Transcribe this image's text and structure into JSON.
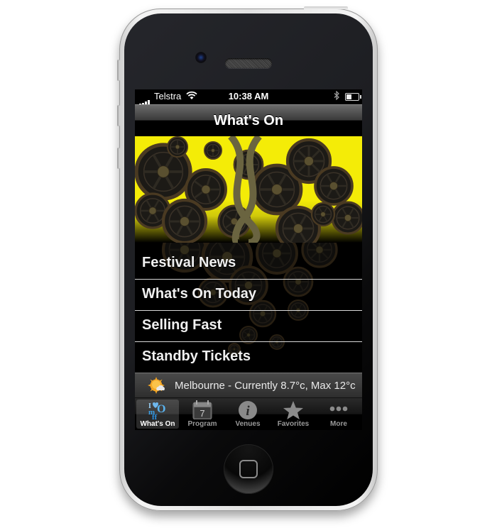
{
  "status_bar": {
    "carrier": "Telstra",
    "time": "10:38 AM",
    "wifi_icon": "wifi-icon",
    "bluetooth_icon": "bluetooth-icon",
    "battery_level": 0.45
  },
  "nav": {
    "title": "What's On"
  },
  "hero": {
    "image": "gears-heart-dna-artwork"
  },
  "menu": {
    "items": [
      {
        "label": "Festival News"
      },
      {
        "label": "What's On Today"
      },
      {
        "label": "Selling Fast"
      },
      {
        "label": "Standby Tickets"
      }
    ]
  },
  "weather": {
    "icon": "sun-cloud-icon",
    "text": "Melbourne - Currently 8.7°c, Max 12°c"
  },
  "tabs": [
    {
      "label": "What's On",
      "icon": "imiff-logo-icon",
      "active": true
    },
    {
      "label": "Program",
      "icon": "calendar-icon",
      "calendar_day": "7",
      "calendar_header": "Calendar",
      "active": false
    },
    {
      "label": "Venues",
      "icon": "info-icon",
      "glyph": "i",
      "active": false
    },
    {
      "label": "Favorites",
      "icon": "star-icon",
      "active": false
    },
    {
      "label": "More",
      "icon": "more-dots-icon",
      "active": false
    }
  ],
  "colors": {
    "hero_yellow": "#f4ec07",
    "gear_brown": "#4a3a22",
    "accent_blue": "#3aa0e8"
  }
}
